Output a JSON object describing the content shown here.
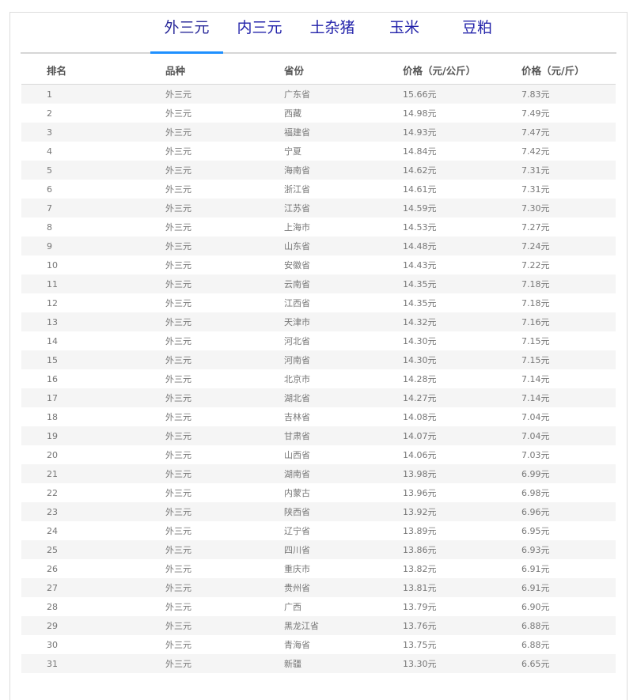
{
  "tabs": [
    "外三元",
    "内三元",
    "土杂猪",
    "玉米",
    "豆粕"
  ],
  "headers": [
    "排名",
    "品种",
    "省份",
    "价格（元/公斤）",
    "价格（元/斤）"
  ],
  "rows": [
    [
      "1",
      "外三元",
      "广东省",
      "15.66元",
      "7.83元"
    ],
    [
      "2",
      "外三元",
      "西藏",
      "14.98元",
      "7.49元"
    ],
    [
      "3",
      "外三元",
      "福建省",
      "14.93元",
      "7.47元"
    ],
    [
      "4",
      "外三元",
      "宁夏",
      "14.84元",
      "7.42元"
    ],
    [
      "5",
      "外三元",
      "海南省",
      "14.62元",
      "7.31元"
    ],
    [
      "6",
      "外三元",
      "浙江省",
      "14.61元",
      "7.31元"
    ],
    [
      "7",
      "外三元",
      "江苏省",
      "14.59元",
      "7.30元"
    ],
    [
      "8",
      "外三元",
      "上海市",
      "14.53元",
      "7.27元"
    ],
    [
      "9",
      "外三元",
      "山东省",
      "14.48元",
      "7.24元"
    ],
    [
      "10",
      "外三元",
      "安徽省",
      "14.43元",
      "7.22元"
    ],
    [
      "11",
      "外三元",
      "云南省",
      "14.35元",
      "7.18元"
    ],
    [
      "12",
      "外三元",
      "江西省",
      "14.35元",
      "7.18元"
    ],
    [
      "13",
      "外三元",
      "天津市",
      "14.32元",
      "7.16元"
    ],
    [
      "14",
      "外三元",
      "河北省",
      "14.30元",
      "7.15元"
    ],
    [
      "15",
      "外三元",
      "河南省",
      "14.30元",
      "7.15元"
    ],
    [
      "16",
      "外三元",
      "北京市",
      "14.28元",
      "7.14元"
    ],
    [
      "17",
      "外三元",
      "湖北省",
      "14.27元",
      "7.14元"
    ],
    [
      "18",
      "外三元",
      "吉林省",
      "14.08元",
      "7.04元"
    ],
    [
      "19",
      "外三元",
      "甘肃省",
      "14.07元",
      "7.04元"
    ],
    [
      "20",
      "外三元",
      "山西省",
      "14.06元",
      "7.03元"
    ],
    [
      "21",
      "外三元",
      "湖南省",
      "13.98元",
      "6.99元"
    ],
    [
      "22",
      "外三元",
      "内蒙古",
      "13.96元",
      "6.98元"
    ],
    [
      "23",
      "外三元",
      "陕西省",
      "13.92元",
      "6.96元"
    ],
    [
      "24",
      "外三元",
      "辽宁省",
      "13.89元",
      "6.95元"
    ],
    [
      "25",
      "外三元",
      "四川省",
      "13.86元",
      "6.93元"
    ],
    [
      "26",
      "外三元",
      "重庆市",
      "13.82元",
      "6.91元"
    ],
    [
      "27",
      "外三元",
      "贵州省",
      "13.81元",
      "6.91元"
    ],
    [
      "28",
      "外三元",
      "广西",
      "13.79元",
      "6.90元"
    ],
    [
      "29",
      "外三元",
      "黑龙江省",
      "13.76元",
      "6.88元"
    ],
    [
      "30",
      "外三元",
      "青海省",
      "13.75元",
      "6.88元"
    ],
    [
      "31",
      "外三元",
      "新疆",
      "13.30元",
      "6.65元"
    ]
  ],
  "colors": {
    "tab_text": "#2222aa",
    "tab_underline": "#1e90ff",
    "row_stripe": "#f5f5f5"
  }
}
